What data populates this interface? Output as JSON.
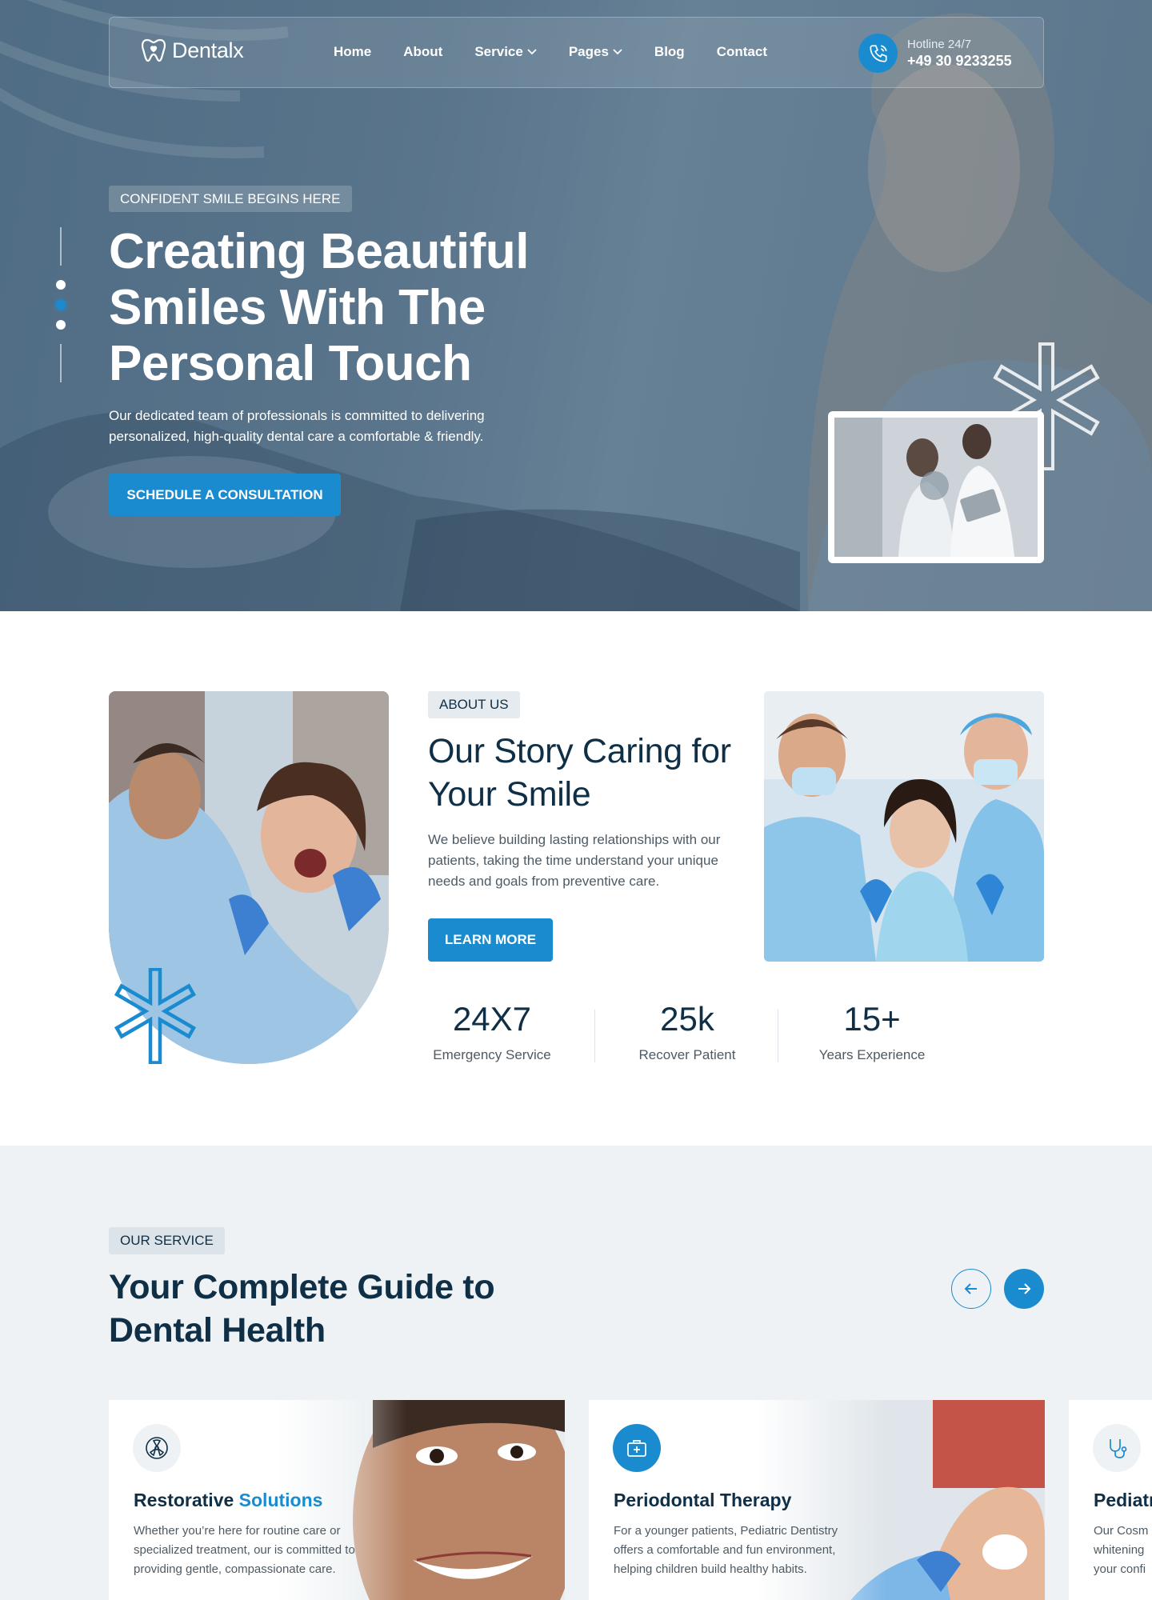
{
  "brand": {
    "name": "Dentalx",
    "accent_color": "#1b8bd0",
    "dark_color": "#0f2f47"
  },
  "nav": {
    "items": [
      {
        "label": "Home"
      },
      {
        "label": "About"
      },
      {
        "label": "Service",
        "has_dropdown": true
      },
      {
        "label": "Pages",
        "has_dropdown": true
      },
      {
        "label": "Blog"
      },
      {
        "label": "Contact"
      }
    ],
    "hotline_label": "Hotline 24/7",
    "hotline_number": "+49 30 9233255",
    "hotline_icon": "phone-icon"
  },
  "hero": {
    "badge": "CONFIDENT SMILE BEGINS HERE",
    "title": "Creating Beautiful Smiles With The Personal Touch",
    "text": "Our dedicated team of professionals is committed to delivering personalized, high-quality dental care a comfortable & friendly.",
    "cta": "SCHEDULE A CONSULTATION",
    "slide_count": 3,
    "active_slide": 2
  },
  "about": {
    "badge": "ABOUT US",
    "title": "Our Story Caring for Your Smile",
    "text": "We believe building lasting relationships with our patients, taking the time understand your unique needs and goals from preventive care.",
    "cta": "LEARN MORE",
    "stats": [
      {
        "value": "24X7",
        "label": "Emergency Service"
      },
      {
        "value": "25k",
        "label": "Recover Patient"
      },
      {
        "value": "15+",
        "label": "Years Experience"
      }
    ]
  },
  "services": {
    "badge": "OUR SERVICE",
    "title": "Your Complete Guide to Dental Health",
    "prev_icon": "arrow-left-icon",
    "next_icon": "arrow-right-icon",
    "cards": [
      {
        "title_main": "Restorative ",
        "title_accent": "Solutions",
        "text": "Whether you’re here for routine care or specialized treatment, our is committed to providing gentle, compassionate care.",
        "icon": "radiation-icon"
      },
      {
        "title_main": "Periodontal Therapy",
        "title_accent": "",
        "text": "For a younger patients, Pediatric Dentistry offers a comfortable and fun environment, helping children build healthy habits.",
        "icon": "first-aid-kit-icon"
      },
      {
        "title_main": "Pediatr",
        "title_accent": "",
        "text": "Our Cosm whitening your confi",
        "icon": "stethoscope-icon"
      }
    ]
  }
}
